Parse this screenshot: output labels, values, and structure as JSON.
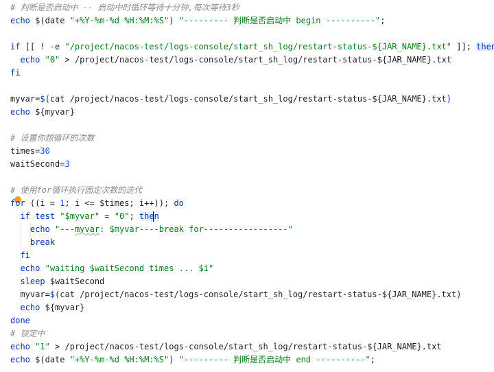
{
  "lines": [
    "# 判断是否启动中 -- 启动中时循环等待十分钟,每次等待3秒",
    "echo $(date \"+%Y-%m-%d %H:%M:%S\") \"--------- 判断是否启动中 begin ----------\";",
    "",
    "if [[ ! -e \"/project/nacos-test/logs-console/start_sh_log/restart-status-${JAR_NAME}.txt\" ]]; then",
    "  echo \"0\" > /project/nacos-test/logs-console/start_sh_log/restart-status-${JAR_NAME}.txt",
    "fi",
    "",
    "myvar=$(cat /project/nacos-test/logs-console/start_sh_log/restart-status-${JAR_NAME}.txt)",
    "echo ${myvar}",
    "",
    "# 设置你想循环的次数",
    "times=30",
    "waitSecond=3",
    "",
    "# 使用for循环执行固定次数的迭代",
    "for ((i = 1; i <= $times; i++)); do",
    "  if test \"$myvar\" = \"0\"; then",
    "    echo \"---myvar: $myvar----break for-----------------\"",
    "    break",
    "  fi",
    "  echo \"waiting $waitSecond times ... $i\"",
    "  sleep $waitSecond",
    "  myvar=$(cat /project/nacos-test/logs-console/start_sh_log/restart-status-${JAR_NAME}.txt)",
    "  echo ${myvar}",
    "done",
    "# 锁定中",
    "echo \"1\" > /project/nacos-test/logs-console/start_sh_log/restart-status-${JAR_NAME}.txt",
    "echo $(date \"+%Y-%m-%d %H:%M:%S\") \"--------- 判断是否启动中 end ----------\";"
  ],
  "colors": {
    "keyword": "#0033b3",
    "string": "#067d17",
    "comment": "#8c8c8c",
    "number": "#1750eb",
    "background": "#ffffff"
  },
  "gutter_icon": "intention-bulb-icon"
}
